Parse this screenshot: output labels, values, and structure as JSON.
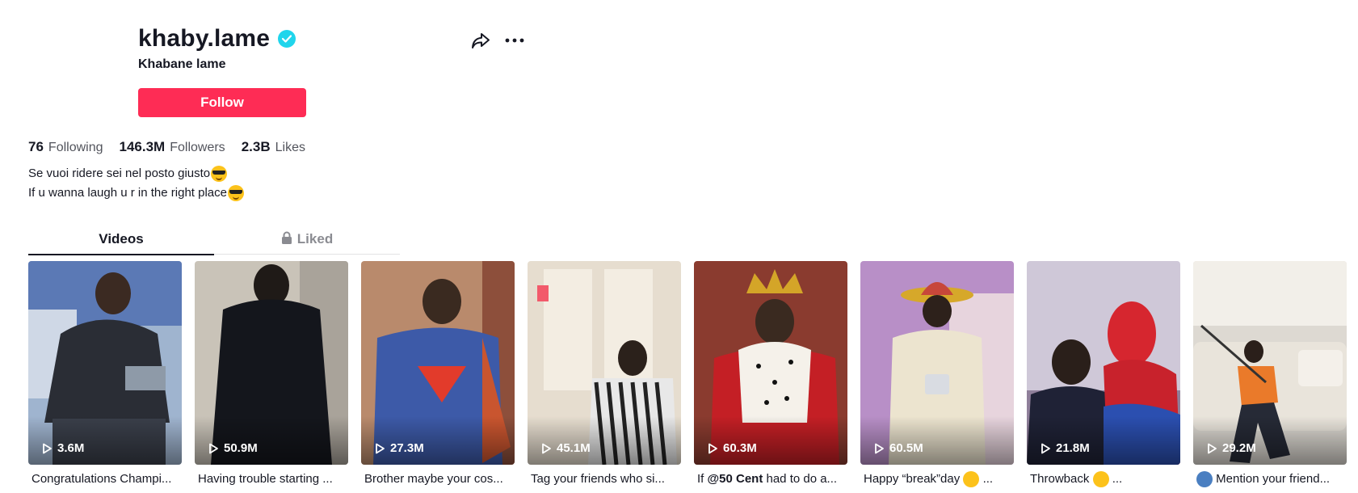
{
  "profile": {
    "username": "khaby.lame",
    "nickname": "Khabane lame",
    "follow_label": "Follow",
    "verified_color": "#20d5ec",
    "accent_color": "#fe2c55"
  },
  "stats": {
    "following_count": "76",
    "following_label": "Following",
    "followers_count": "146.3M",
    "followers_label": "Followers",
    "likes_count": "2.3B",
    "likes_label": "Likes"
  },
  "bio": {
    "line1": "Se vuoi ridere sei nel posto giusto",
    "line2": "If u wanna laugh u r in the right place",
    "emoji_icon": "sunglasses-emoji"
  },
  "tabs": {
    "videos": "Videos",
    "liked": "Liked"
  },
  "videos": [
    {
      "views": "3.6M",
      "caption": "Congratulations Champi..."
    },
    {
      "views": "50.9M",
      "caption": "Having trouble starting ..."
    },
    {
      "views": "27.3M",
      "caption": "Brother maybe your cos..."
    },
    {
      "views": "45.1M",
      "caption": "Tag your friends who si..."
    },
    {
      "views": "60.3M",
      "caption_pre": "If ",
      "caption_bold": "@50 Cent",
      "caption_post": " had to do a..."
    },
    {
      "views": "60.5M",
      "caption_pre": "Happy “break”day ",
      "caption_post": " ..."
    },
    {
      "views": "21.8M",
      "caption_pre": "Throwback ",
      "caption_post": " ..."
    },
    {
      "views": "29.2M",
      "caption_post": " Mention your friend..."
    }
  ]
}
